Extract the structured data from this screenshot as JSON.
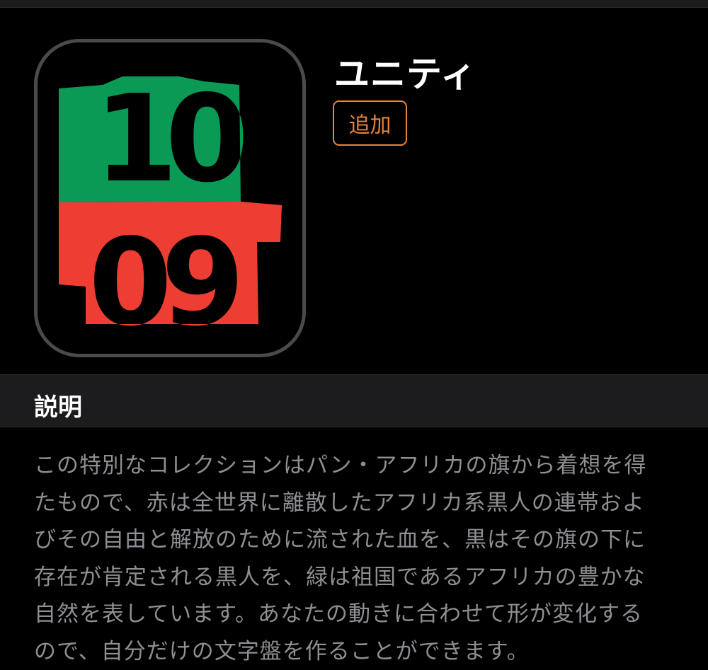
{
  "face": {
    "title": "ユニティ",
    "add_button_label": "追加",
    "time": {
      "hour": "10",
      "minute": "09"
    },
    "colors": {
      "green": "#0a9a56",
      "red": "#ee3e34",
      "black": "#000000",
      "frame": "#4a4a4c"
    }
  },
  "section": {
    "title": "説明"
  },
  "description": {
    "lines": [
      "この特別なコレクションはパン・アフリカの旗から着想を得",
      "たもので、赤は全世界に離散したアフリカ系黒人の連帯およ",
      "びその自由と解放のために流された血を、黒はその旗の下に",
      "存在が肯定される黒人を、緑は祖国であるアフリカの豊かな",
      "自然を表しています。あなたの動きに合わせて形が変化する",
      "ので、自分だけの文字盤を作ることができます。"
    ]
  },
  "accent_color": "#e8843a"
}
